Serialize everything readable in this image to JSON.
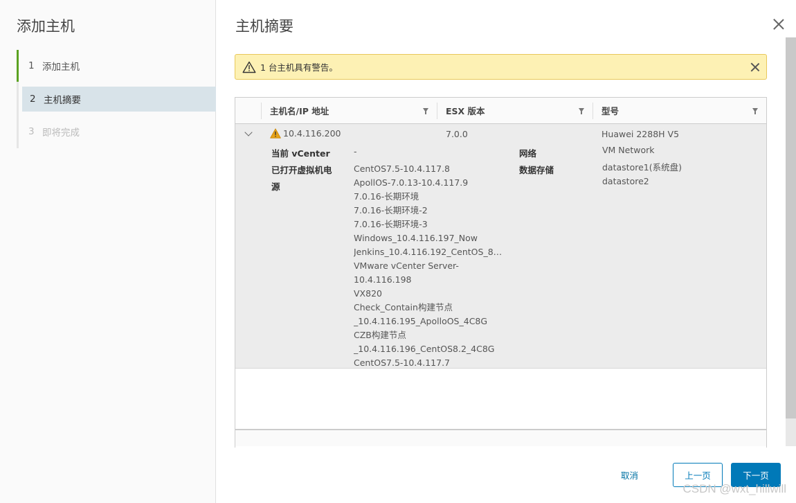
{
  "sidebar": {
    "title": "添加主机",
    "steps": [
      {
        "num": "1",
        "label": "添加主机",
        "state": "done"
      },
      {
        "num": "2",
        "label": "主机摘要",
        "state": "active"
      },
      {
        "num": "3",
        "label": "即将完成",
        "state": "disabled"
      }
    ]
  },
  "main": {
    "title": "主机摘要",
    "alert": {
      "text": "1 台主机具有警告。",
      "color": "#fdf1b4"
    },
    "grid": {
      "columns": [
        "主机名/IP 地址",
        "ESX 版本",
        "型号"
      ],
      "row": {
        "host": "10.4.116.200",
        "esx": "7.0.0",
        "model": "Huawei 2288H V5",
        "vcenter_label": "当前 vCenter",
        "vcenter_value": "-",
        "vms_label_1": "已打开虚拟机电",
        "vms_label_2": "源",
        "vms": [
          "CentOS7.5-10.4.117.8",
          "ApollOS-7.0.13-10.4.117.9",
          "7.0.16-长期环境",
          "7.0.16-长期环境-2",
          "7.0.16-长期环境-3",
          "Windows_10.4.116.197_Now",
          "Jenkins_10.4.116.192_CentOS_8C...",
          "VMware vCenter Server-",
          "10.4.116.198",
          "VX820",
          "Check_Contain构建节点",
          "_10.4.116.195_ApolloOS_4C8G",
          "CZB构建节点",
          "_10.4.116.196_CentOS8.2_4C8G",
          "CentOS7.5-10.4.117.7"
        ],
        "network_label": "网络",
        "network_value": "VM Network",
        "datastore_label": "数据存储",
        "datastores": [
          "datastore1(系统盘)",
          "datastore2"
        ]
      }
    }
  },
  "footer": {
    "cancel": "取消",
    "prev": "上一页",
    "next": "下一页"
  },
  "watermark": "CSDN @wxt_hillwill",
  "colors": {
    "accent": "#0079b8",
    "step_done": "#5aa220",
    "warning": "#e8a317"
  }
}
